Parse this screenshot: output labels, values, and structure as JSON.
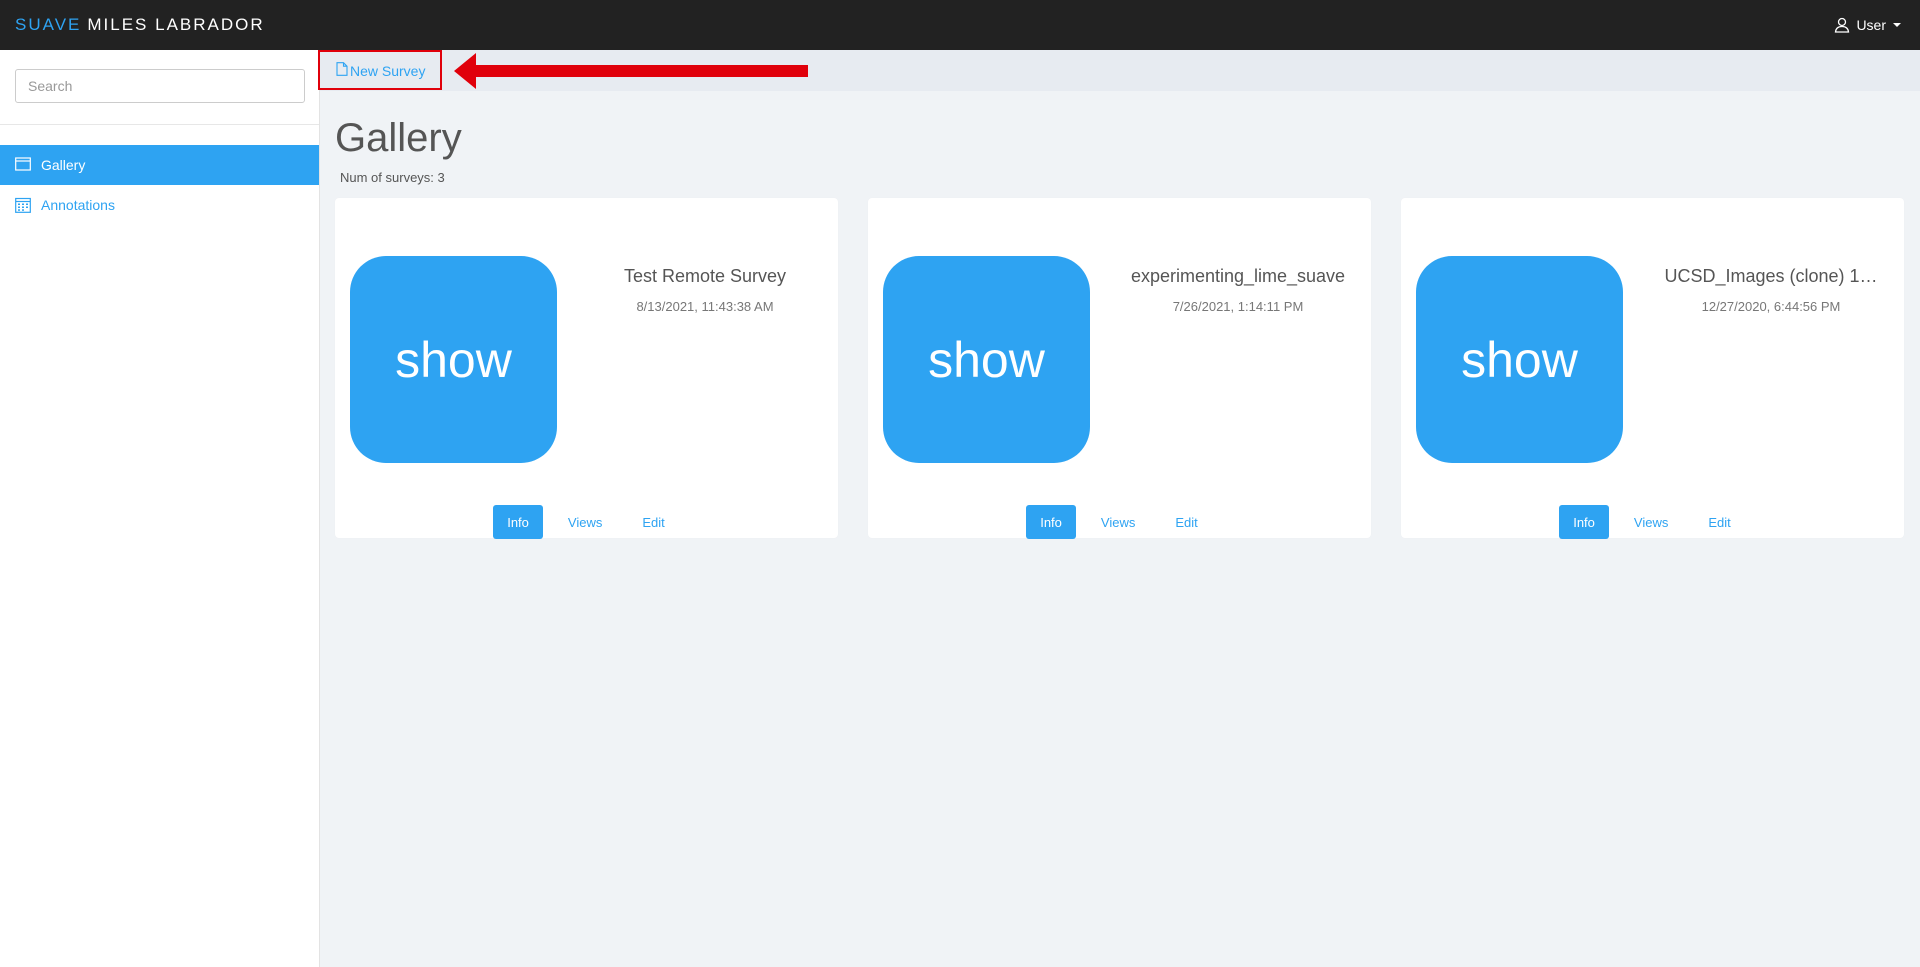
{
  "header": {
    "brand_part1": "SUAVE",
    "brand_part2": "MILES LABRADOR",
    "user_label": "User",
    "user_icon": "user-icon"
  },
  "sidebar": {
    "search_placeholder": "Search",
    "items": [
      {
        "label": "Gallery",
        "icon": "gallery-icon",
        "active": true
      },
      {
        "label": "Annotations",
        "icon": "calendar-icon",
        "active": false
      }
    ]
  },
  "breadcrumb": {
    "new_survey_label": "New Survey",
    "icon": "file-icon"
  },
  "main": {
    "title": "Gallery",
    "count_text": "Num of surveys: 3"
  },
  "cards": [
    {
      "thumb_label": "show",
      "title": "Test Remote Survey",
      "date": "8/13/2021, 11:43:38 AM",
      "actions": [
        "Info",
        "Views",
        "Edit"
      ]
    },
    {
      "thumb_label": "show",
      "title": "experimenting_lime_suave",
      "date": "7/26/2021, 1:14:11 PM",
      "actions": [
        "Info",
        "Views",
        "Edit"
      ]
    },
    {
      "thumb_label": "show",
      "title": "UCSD_Images (clone) 1…",
      "date": "12/27/2020, 6:44:56 PM",
      "actions": [
        "Info",
        "Views",
        "Edit"
      ]
    }
  ],
  "colors": {
    "accent": "#2ea3f2",
    "topbar": "#222222",
    "annotation_red": "#e0000b"
  }
}
